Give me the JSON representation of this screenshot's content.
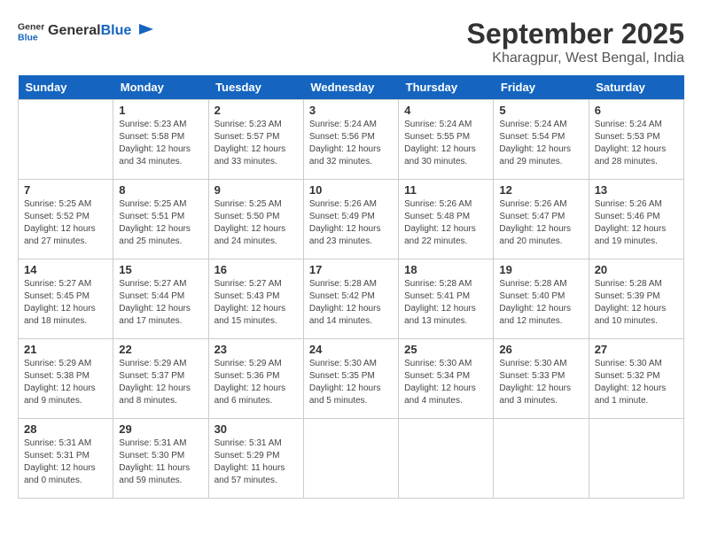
{
  "header": {
    "logo_general": "General",
    "logo_blue": "Blue",
    "title": "September 2025",
    "location": "Kharagpur, West Bengal, India"
  },
  "days_of_week": [
    "Sunday",
    "Monday",
    "Tuesday",
    "Wednesday",
    "Thursday",
    "Friday",
    "Saturday"
  ],
  "weeks": [
    [
      {
        "day": "",
        "sunrise": "",
        "sunset": "",
        "daylight": ""
      },
      {
        "day": "1",
        "sunrise": "Sunrise: 5:23 AM",
        "sunset": "Sunset: 5:58 PM",
        "daylight": "Daylight: 12 hours and 34 minutes."
      },
      {
        "day": "2",
        "sunrise": "Sunrise: 5:23 AM",
        "sunset": "Sunset: 5:57 PM",
        "daylight": "Daylight: 12 hours and 33 minutes."
      },
      {
        "day": "3",
        "sunrise": "Sunrise: 5:24 AM",
        "sunset": "Sunset: 5:56 PM",
        "daylight": "Daylight: 12 hours and 32 minutes."
      },
      {
        "day": "4",
        "sunrise": "Sunrise: 5:24 AM",
        "sunset": "Sunset: 5:55 PM",
        "daylight": "Daylight: 12 hours and 30 minutes."
      },
      {
        "day": "5",
        "sunrise": "Sunrise: 5:24 AM",
        "sunset": "Sunset: 5:54 PM",
        "daylight": "Daylight: 12 hours and 29 minutes."
      },
      {
        "day": "6",
        "sunrise": "Sunrise: 5:24 AM",
        "sunset": "Sunset: 5:53 PM",
        "daylight": "Daylight: 12 hours and 28 minutes."
      }
    ],
    [
      {
        "day": "7",
        "sunrise": "Sunrise: 5:25 AM",
        "sunset": "Sunset: 5:52 PM",
        "daylight": "Daylight: 12 hours and 27 minutes."
      },
      {
        "day": "8",
        "sunrise": "Sunrise: 5:25 AM",
        "sunset": "Sunset: 5:51 PM",
        "daylight": "Daylight: 12 hours and 25 minutes."
      },
      {
        "day": "9",
        "sunrise": "Sunrise: 5:25 AM",
        "sunset": "Sunset: 5:50 PM",
        "daylight": "Daylight: 12 hours and 24 minutes."
      },
      {
        "day": "10",
        "sunrise": "Sunrise: 5:26 AM",
        "sunset": "Sunset: 5:49 PM",
        "daylight": "Daylight: 12 hours and 23 minutes."
      },
      {
        "day": "11",
        "sunrise": "Sunrise: 5:26 AM",
        "sunset": "Sunset: 5:48 PM",
        "daylight": "Daylight: 12 hours and 22 minutes."
      },
      {
        "day": "12",
        "sunrise": "Sunrise: 5:26 AM",
        "sunset": "Sunset: 5:47 PM",
        "daylight": "Daylight: 12 hours and 20 minutes."
      },
      {
        "day": "13",
        "sunrise": "Sunrise: 5:26 AM",
        "sunset": "Sunset: 5:46 PM",
        "daylight": "Daylight: 12 hours and 19 minutes."
      }
    ],
    [
      {
        "day": "14",
        "sunrise": "Sunrise: 5:27 AM",
        "sunset": "Sunset: 5:45 PM",
        "daylight": "Daylight: 12 hours and 18 minutes."
      },
      {
        "day": "15",
        "sunrise": "Sunrise: 5:27 AM",
        "sunset": "Sunset: 5:44 PM",
        "daylight": "Daylight: 12 hours and 17 minutes."
      },
      {
        "day": "16",
        "sunrise": "Sunrise: 5:27 AM",
        "sunset": "Sunset: 5:43 PM",
        "daylight": "Daylight: 12 hours and 15 minutes."
      },
      {
        "day": "17",
        "sunrise": "Sunrise: 5:28 AM",
        "sunset": "Sunset: 5:42 PM",
        "daylight": "Daylight: 12 hours and 14 minutes."
      },
      {
        "day": "18",
        "sunrise": "Sunrise: 5:28 AM",
        "sunset": "Sunset: 5:41 PM",
        "daylight": "Daylight: 12 hours and 13 minutes."
      },
      {
        "day": "19",
        "sunrise": "Sunrise: 5:28 AM",
        "sunset": "Sunset: 5:40 PM",
        "daylight": "Daylight: 12 hours and 12 minutes."
      },
      {
        "day": "20",
        "sunrise": "Sunrise: 5:28 AM",
        "sunset": "Sunset: 5:39 PM",
        "daylight": "Daylight: 12 hours and 10 minutes."
      }
    ],
    [
      {
        "day": "21",
        "sunrise": "Sunrise: 5:29 AM",
        "sunset": "Sunset: 5:38 PM",
        "daylight": "Daylight: 12 hours and 9 minutes."
      },
      {
        "day": "22",
        "sunrise": "Sunrise: 5:29 AM",
        "sunset": "Sunset: 5:37 PM",
        "daylight": "Daylight: 12 hours and 8 minutes."
      },
      {
        "day": "23",
        "sunrise": "Sunrise: 5:29 AM",
        "sunset": "Sunset: 5:36 PM",
        "daylight": "Daylight: 12 hours and 6 minutes."
      },
      {
        "day": "24",
        "sunrise": "Sunrise: 5:30 AM",
        "sunset": "Sunset: 5:35 PM",
        "daylight": "Daylight: 12 hours and 5 minutes."
      },
      {
        "day": "25",
        "sunrise": "Sunrise: 5:30 AM",
        "sunset": "Sunset: 5:34 PM",
        "daylight": "Daylight: 12 hours and 4 minutes."
      },
      {
        "day": "26",
        "sunrise": "Sunrise: 5:30 AM",
        "sunset": "Sunset: 5:33 PM",
        "daylight": "Daylight: 12 hours and 3 minutes."
      },
      {
        "day": "27",
        "sunrise": "Sunrise: 5:30 AM",
        "sunset": "Sunset: 5:32 PM",
        "daylight": "Daylight: 12 hours and 1 minute."
      }
    ],
    [
      {
        "day": "28",
        "sunrise": "Sunrise: 5:31 AM",
        "sunset": "Sunset: 5:31 PM",
        "daylight": "Daylight: 12 hours and 0 minutes."
      },
      {
        "day": "29",
        "sunrise": "Sunrise: 5:31 AM",
        "sunset": "Sunset: 5:30 PM",
        "daylight": "Daylight: 11 hours and 59 minutes."
      },
      {
        "day": "30",
        "sunrise": "Sunrise: 5:31 AM",
        "sunset": "Sunset: 5:29 PM",
        "daylight": "Daylight: 11 hours and 57 minutes."
      },
      {
        "day": "",
        "sunrise": "",
        "sunset": "",
        "daylight": ""
      },
      {
        "day": "",
        "sunrise": "",
        "sunset": "",
        "daylight": ""
      },
      {
        "day": "",
        "sunrise": "",
        "sunset": "",
        "daylight": ""
      },
      {
        "day": "",
        "sunrise": "",
        "sunset": "",
        "daylight": ""
      }
    ]
  ]
}
